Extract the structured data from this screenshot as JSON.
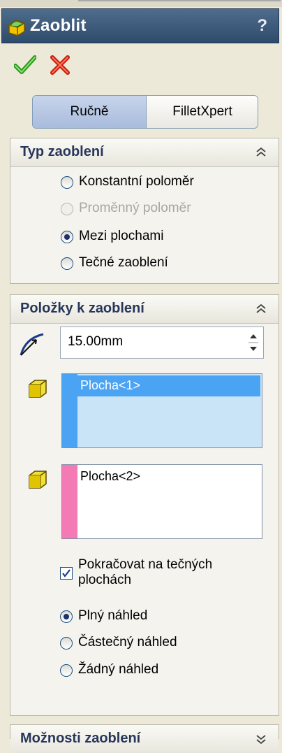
{
  "window": {
    "title": "Zaoblit",
    "help_label": "?"
  },
  "actions": {
    "ok": "ok-check",
    "cancel": "cancel-x"
  },
  "mode_toggle": {
    "manual": "Ručně",
    "expert": "FilletXpert"
  },
  "fillet_type": {
    "title": "Typ zaoblení",
    "options": [
      "Konstantní poloměr",
      "Proměnný poloměr",
      "Mezi plochami",
      "Tečné zaoblení"
    ],
    "selected_index": 2,
    "disabled_index": 1
  },
  "fillet_items": {
    "title": "Položky k zaoblení",
    "radius_value": "15.00mm",
    "face_set_1": [
      "Plocha<1>"
    ],
    "face_set_2": [
      "Plocha<2>"
    ],
    "tangent_propagation": {
      "label": "Pokračovat na tečných plochách",
      "checked": true
    },
    "preview_options": [
      "Plný náhled",
      "Částečný náhled",
      "Žádný náhled"
    ],
    "preview_selected_index": 0
  },
  "fillet_options": {
    "title": "Možnosti zaoblení"
  },
  "colors": {
    "face_set_1": "#4aa3f3",
    "face_set_2": "#f37ab4",
    "title_bar": "#3b5a7c"
  }
}
